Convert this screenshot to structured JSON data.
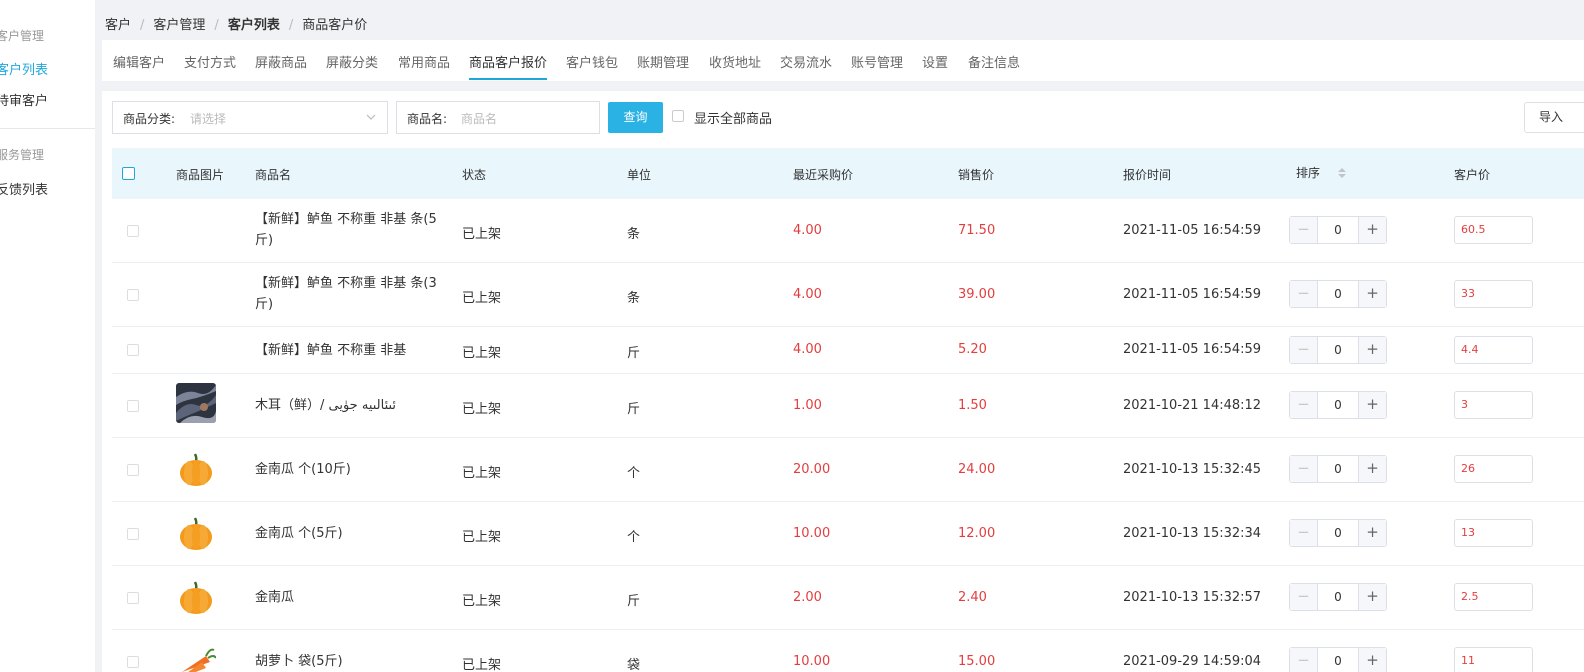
{
  "sidebar": {
    "groups": [
      {
        "title": "客户管理",
        "items": [
          {
            "label": "客户列表",
            "active": true
          },
          {
            "label": "待审客户",
            "active": false
          }
        ]
      },
      {
        "title": "服务管理",
        "items": [
          {
            "label": "反馈列表",
            "active": false
          }
        ]
      }
    ]
  },
  "breadcrumb": [
    "客户",
    "客户管理",
    "客户列表",
    "商品客户价"
  ],
  "tabs": [
    {
      "label": "编辑客户"
    },
    {
      "label": "支付方式"
    },
    {
      "label": "屏蔽商品"
    },
    {
      "label": "屏蔽分类"
    },
    {
      "label": "常用商品"
    },
    {
      "label": "商品客户报价",
      "active": true
    },
    {
      "label": "客户钱包"
    },
    {
      "label": "账期管理"
    },
    {
      "label": "收货地址"
    },
    {
      "label": "交易流水"
    },
    {
      "label": "账号管理"
    },
    {
      "label": "设置"
    },
    {
      "label": "备注信息"
    }
  ],
  "filters": {
    "category_label": "商品分类:",
    "category_placeholder": "请选择",
    "name_label": "商品名:",
    "name_placeholder": "商品名",
    "query_button": "查询",
    "show_all_label": "显示全部商品",
    "import_button": "导入"
  },
  "table": {
    "columns": [
      "商品图片",
      "商品名",
      "状态",
      "单位",
      "最近采购价",
      "销售价",
      "报价时间",
      "排序",
      "客户价"
    ],
    "rows": [
      {
        "image": "",
        "name": "【新鲜】鲈鱼 不称重 非基 条(5斤)",
        "status": "已上架",
        "unit": "条",
        "purchase": "4.00",
        "sale": "71.50",
        "time": "2021-11-05 16:54:59",
        "sort": "0",
        "price": "60.5"
      },
      {
        "image": "",
        "name": "【新鲜】鲈鱼 不称重 非基 条(3斤)",
        "status": "已上架",
        "unit": "条",
        "purchase": "4.00",
        "sale": "39.00",
        "time": "2021-11-05 16:54:59",
        "sort": "0",
        "price": "33"
      },
      {
        "image": "",
        "name": "【新鲜】鲈鱼 不称重 非基",
        "status": "已上架",
        "unit": "斤",
        "purchase": "4.00",
        "sale": "5.20",
        "time": "2021-11-05 16:54:59",
        "sort": "0",
        "price": "4.4"
      },
      {
        "image": "fungus",
        "name": "木耳（鲜）/ ئىئالىيە جۈيى",
        "status": "已上架",
        "unit": "斤",
        "purchase": "1.00",
        "sale": "1.50",
        "time": "2021-10-21 14:48:12",
        "sort": "0",
        "price": "3"
      },
      {
        "image": "pumpkin",
        "name": "金南瓜 个(10斤)",
        "status": "已上架",
        "unit": "个",
        "purchase": "20.00",
        "sale": "24.00",
        "time": "2021-10-13 15:32:45",
        "sort": "0",
        "price": "26"
      },
      {
        "image": "pumpkin",
        "name": "金南瓜 个(5斤)",
        "status": "已上架",
        "unit": "个",
        "purchase": "10.00",
        "sale": "12.00",
        "time": "2021-10-13 15:32:34",
        "sort": "0",
        "price": "13"
      },
      {
        "image": "pumpkin",
        "name": "金南瓜",
        "status": "已上架",
        "unit": "斤",
        "purchase": "2.00",
        "sale": "2.40",
        "time": "2021-10-13 15:32:57",
        "sort": "0",
        "price": "2.5"
      },
      {
        "image": "carrot",
        "name": "胡萝卜 袋(5斤)",
        "status": "已上架",
        "unit": "袋",
        "purchase": "10.00",
        "sale": "15.00",
        "time": "2021-09-29 14:59:04",
        "sort": "0",
        "price": "11"
      }
    ]
  },
  "colors": {
    "accent": "#1fa7dc",
    "price_red": "#e33e3e",
    "header_bg": "#e9f7fc"
  }
}
